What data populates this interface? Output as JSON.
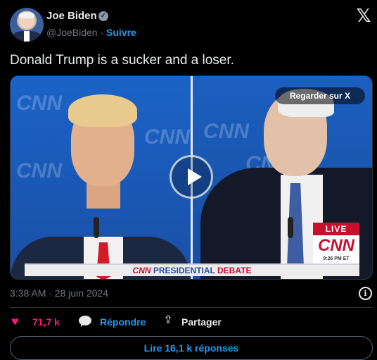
{
  "author": {
    "name": "Joe Biden",
    "handle": "@JoeBiden",
    "separator": "·",
    "follow_label": "Suivre"
  },
  "tweet": {
    "text": "Donald Trump is a sucker and a loser.",
    "timestamp": "3:38 AM · 28 juin 2024"
  },
  "media": {
    "watch_label": "Regarder sur X",
    "live_label": "LIVE",
    "network": "CNN",
    "clock": "9:26 PM ET",
    "banner_network": "CNN",
    "banner_presidential": "PRESIDENTIAL",
    "banner_debate": "DEBATE",
    "background_logo": "CNN"
  },
  "actions": {
    "likes_count": "71,7 k",
    "reply_label": "Répondre",
    "share_label": "Partager"
  },
  "footer": {
    "read_replies_label": "Lire 16,1 k réponses"
  },
  "icons": {
    "verified": "verified-badge-icon",
    "x_logo": "x-logo-icon",
    "info": "info-icon",
    "heart": "heart-icon",
    "reply": "reply-bubble-icon",
    "share": "share-icon",
    "play": "play-icon"
  },
  "colors": {
    "accent": "#1d9bf0",
    "like": "#f91880",
    "background": "#000000",
    "cnn_red": "#c8102e"
  }
}
